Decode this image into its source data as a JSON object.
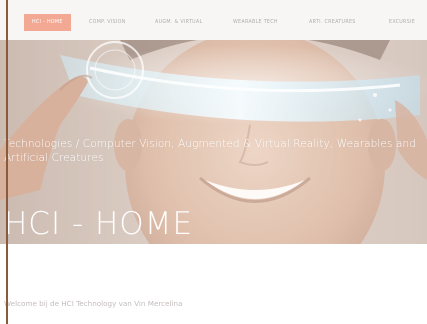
{
  "nav": {
    "items": [
      {
        "label": "HCI - HOME",
        "active": true
      },
      {
        "label": "COMP. VISION",
        "active": false
      },
      {
        "label": "AUGM. & VIRTUAL",
        "active": false
      },
      {
        "label": "WEARABLE TECH",
        "active": false
      },
      {
        "label": "ARTI. CREATURES",
        "active": false
      },
      {
        "label": "EXCURSIE",
        "active": false
      }
    ]
  },
  "hero": {
    "tagline": "Technologies / Computer Vision, Augmented & Virtual Reality, Wearables and Artificial Creatures",
    "title": "HCI - HOME"
  },
  "content": {
    "welcome": "Welcome bij de HCI Technology van Vin Mercelina"
  },
  "colors": {
    "nav_active_bg": "#f3a894",
    "nav_text": "#b3aca9",
    "left_rule": "#8a5a3c",
    "hero_text": "#ffffff",
    "body_text": "#c2bdbb"
  },
  "icons": {
    "hero_image": "man-wearing-holographic-visor-photo"
  }
}
